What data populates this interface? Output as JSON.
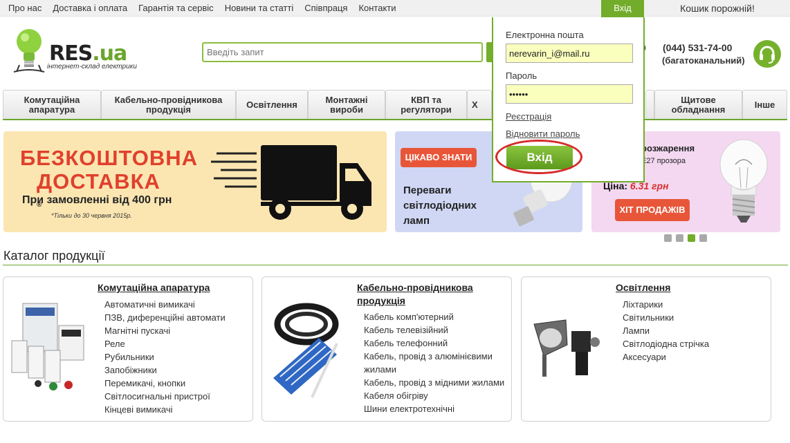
{
  "topnav": {
    "links": [
      "Про нас",
      "Доставка і оплата",
      "Гарантія та сервіс",
      "Новини та статті",
      "Співпраця",
      "Контакти"
    ],
    "login_tab": "Вхід",
    "cart": "Кошик порожній!"
  },
  "header": {
    "logo_main": "RES",
    "logo_ua": ".ua",
    "logo_sub": "інтернет-склад електрики",
    "search_placeholder": "Введіть запит",
    "phone_fragment": "0",
    "phone": "(044) 531-74-00",
    "phone_sub": "(багатоканальний)"
  },
  "categories": [
    "Комутаційна апаратура",
    "Кабельно-провідникова продукція",
    "Освітлення",
    "Монтажні вироби",
    "КВП та регулятори",
    "Х",
    "Щитове обладнання",
    "Інше"
  ],
  "banners": {
    "free_delivery": {
      "line1": "БЕЗКОШТОВНА",
      "line2": "ДОСТАВКА",
      "mark": "®",
      "sub": "При замовленні від 400 грн",
      "note": "*Тільки до 30 червня 2015р."
    },
    "led": {
      "tag": "ЦІКАВО ЗНАТИ",
      "text": "Переваги світлодіодних ламп"
    },
    "incandescent": {
      "title": "розжарення",
      "sub": "Е27 прозора",
      "price_label": "Ціна:",
      "price_value": "6.31 грн",
      "hit": "ХІТ ПРОДАЖІВ"
    },
    "slides": [
      false,
      false,
      true,
      false
    ]
  },
  "catalog": {
    "title": "Каталог продукції",
    "cards": [
      {
        "title": "Комутаційна апаратура",
        "items": [
          "Автоматичні вимикачі",
          "ПЗВ, диференційні автомати",
          "Магнітні пускачі",
          "Реле",
          "Рубильники",
          "Запобіжники",
          "Перемикачі, кнопки",
          "Світлосигнальні пристрої",
          "Кінцеві вимикачі"
        ]
      },
      {
        "title": "Кабельно-провідникова продукція",
        "items": [
          "Кабель комп'ютерний",
          "Кабель телевізійний",
          "Кабель телефонний",
          "Кабель, провід з алюмінієвими жилами",
          "Кабель, провід з мідними жилами",
          "Кабеля обігріву",
          "Шини електротехнічні"
        ]
      },
      {
        "title": "Освітлення",
        "items": [
          "Ліхтарики",
          "Світильники",
          "Лампи",
          "Світлодіодна стрічка",
          "Аксесуари"
        ]
      }
    ]
  },
  "login": {
    "email_label": "Електронна пошта",
    "email_value": "nerevarin_i@mail.ru",
    "password_label": "Пароль",
    "password_value": "••••••",
    "register": "Реєстрація",
    "restore": "Відновити пароль",
    "submit": "Вхід"
  },
  "colors": {
    "accent": "#72ac2a",
    "promo_red": "#e8563a",
    "highlight_ring": "#d72a2a"
  }
}
